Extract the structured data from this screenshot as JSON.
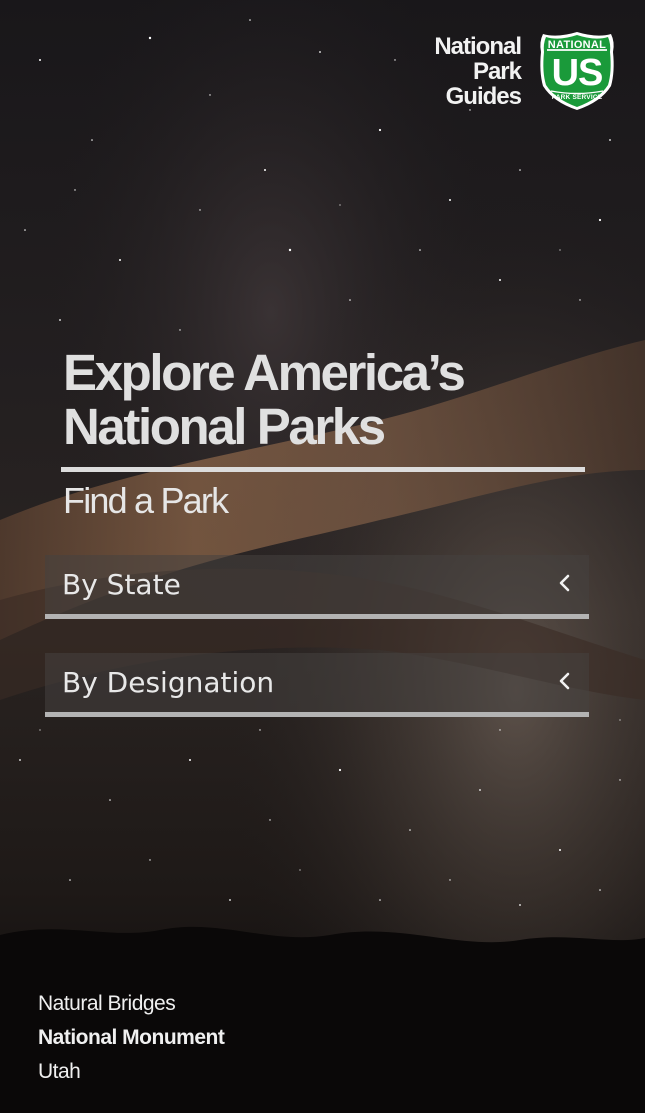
{
  "brand": {
    "line1": "National",
    "line2": "Park",
    "line3": "Guides",
    "shield": {
      "top": "NATIONAL",
      "middle": "US",
      "bottom": "PARK SERVICE",
      "color": "#1a9a3a"
    }
  },
  "hero": {
    "title_line1": "Explore America’s",
    "title_line2": "National Parks",
    "subtitle": "Find a Park"
  },
  "finders": [
    {
      "label": "By State",
      "icon": "chevron-left-icon"
    },
    {
      "label": "By Designation",
      "icon": "chevron-left-icon"
    }
  ],
  "photo_caption": {
    "line1": "Natural Bridges",
    "line2": "National Monument",
    "line3": "Utah"
  },
  "colors": {
    "background": "#0c0a09",
    "text": "#e6e6e6",
    "rule": "#dcdcdc",
    "finder_underline": "#b3b3b3",
    "shield_green": "#1a9a3a"
  }
}
